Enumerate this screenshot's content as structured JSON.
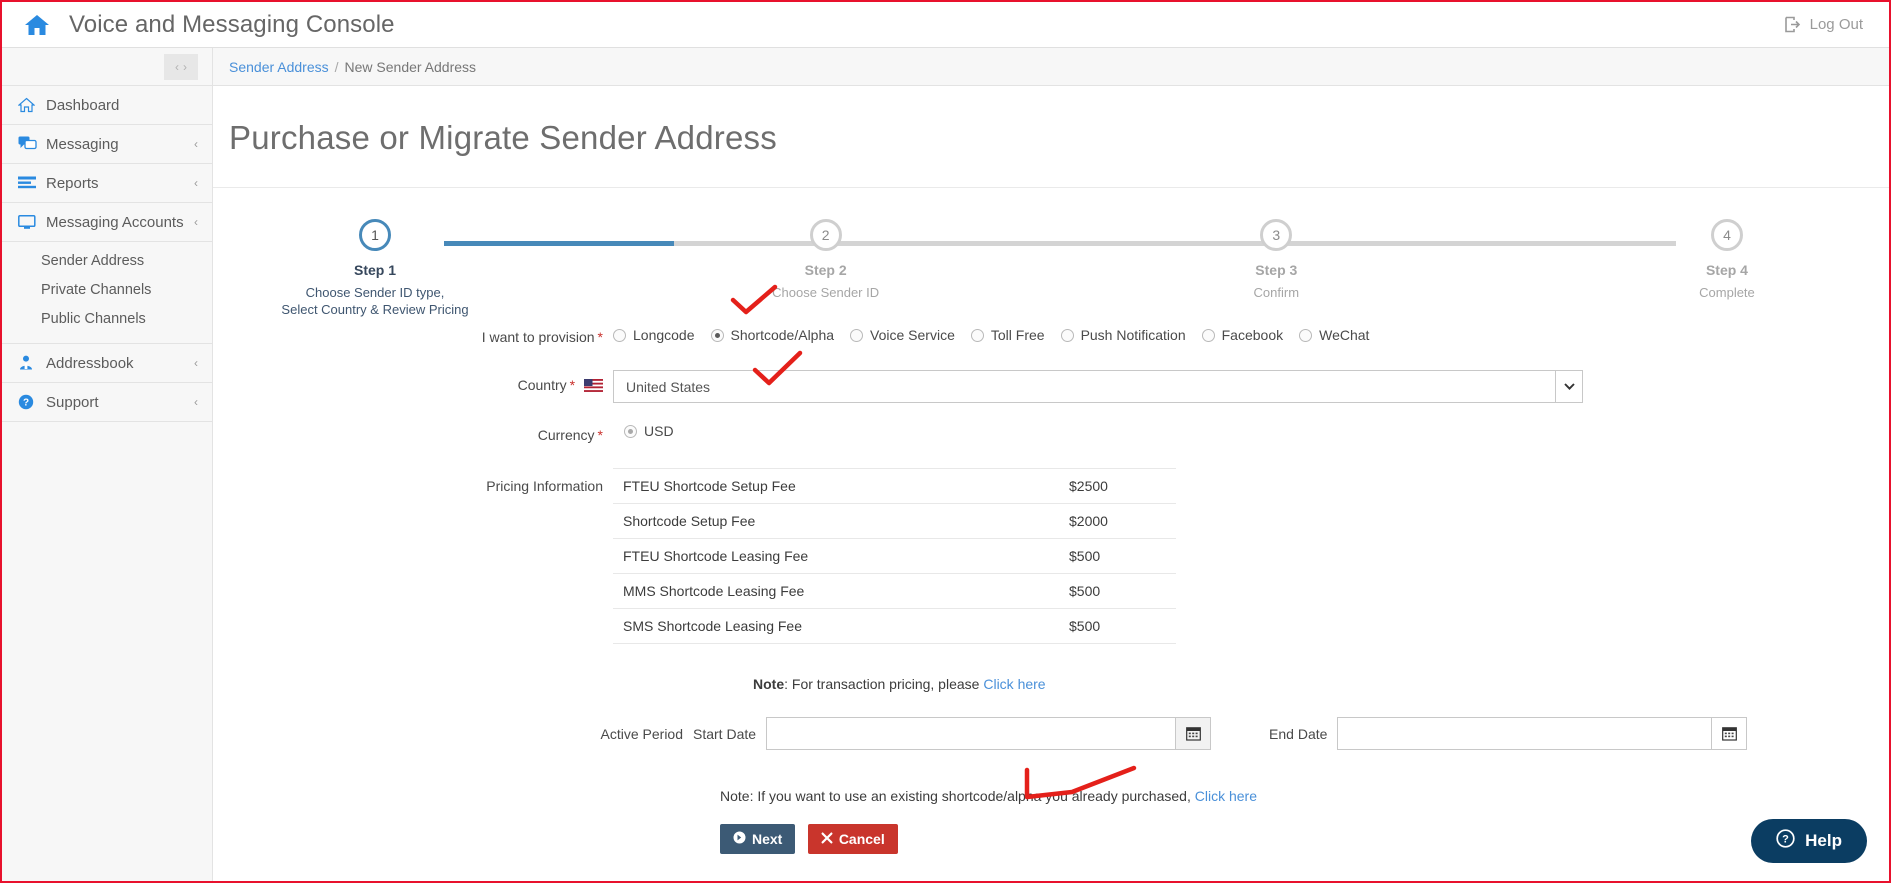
{
  "header": {
    "home_icon": "home-icon",
    "title": "Voice and Messaging Console",
    "logout_label": "Log Out",
    "logout_icon": "logout-icon"
  },
  "sidebar": {
    "collapse_prev": "‹",
    "collapse_next": "›",
    "items": [
      {
        "label": "Dashboard",
        "icon": "dashboard-home-icon",
        "caret": ""
      },
      {
        "label": "Messaging",
        "icon": "messaging-chat-icon",
        "caret": "‹"
      },
      {
        "label": "Reports",
        "icon": "reports-bars-icon",
        "caret": "‹"
      },
      {
        "label": "Messaging Accounts",
        "icon": "monitor-icon",
        "caret": "‹"
      }
    ],
    "sub_items": [
      {
        "label": "Sender Address"
      },
      {
        "label": "Private Channels"
      },
      {
        "label": "Public Channels"
      }
    ],
    "items_bottom": [
      {
        "label": "Addressbook",
        "icon": "addressbook-person-icon",
        "caret": "‹"
      },
      {
        "label": "Support",
        "icon": "support-question-icon",
        "caret": "‹"
      }
    ]
  },
  "breadcrumb": {
    "parent": "Sender Address",
    "separator": "/",
    "current": "New Sender Address"
  },
  "page": {
    "title": "Purchase or Migrate Sender Address"
  },
  "stepper": {
    "steps": [
      {
        "num": "1",
        "name": "Step 1",
        "desc": "Choose Sender ID type,\nSelect Country & Review Pricing",
        "active": true
      },
      {
        "num": "2",
        "name": "Step 2",
        "desc": "Choose Sender ID",
        "active": false
      },
      {
        "num": "3",
        "name": "Step 3",
        "desc": "Confirm",
        "active": false
      },
      {
        "num": "4",
        "name": "Step 4",
        "desc": "Complete",
        "active": false
      }
    ],
    "active_color": "#4789b9",
    "inactive_color": "#d4d4d4"
  },
  "form": {
    "provision": {
      "label": "I want to provision",
      "required": "*",
      "options": [
        {
          "label": "Longcode",
          "checked": false
        },
        {
          "label": "Shortcode/Alpha",
          "checked": true
        },
        {
          "label": "Voice Service",
          "checked": false
        },
        {
          "label": "Toll Free",
          "checked": false
        },
        {
          "label": "Push Notification",
          "checked": false
        },
        {
          "label": "Facebook",
          "checked": false
        },
        {
          "label": "WeChat",
          "checked": false
        }
      ]
    },
    "country": {
      "label": "Country",
      "required": "*",
      "flag_icon": "us-flag-icon",
      "value": "United States",
      "caret_icon": "chevron-down-icon"
    },
    "currency": {
      "label": "Currency",
      "required": "*",
      "value": "USD",
      "checked": true
    },
    "pricing": {
      "label": "Pricing Information",
      "rows": [
        {
          "name": "FTEU Shortcode Setup Fee",
          "amount": "$2500"
        },
        {
          "name": "Shortcode Setup Fee",
          "amount": "$2000"
        },
        {
          "name": "FTEU Shortcode Leasing Fee",
          "amount": "$500"
        },
        {
          "name": "MMS Shortcode Leasing Fee",
          "amount": "$500"
        },
        {
          "name": "SMS Shortcode Leasing Fee",
          "amount": "$500"
        }
      ]
    },
    "pricing_note": {
      "bold": "Note",
      "text": ": For transaction pricing, please ",
      "link": "Click here"
    },
    "active_period": {
      "label": "Active Period",
      "start_label": "Start Date",
      "start_value": "",
      "start_placeholder": "",
      "end_label": "End Date",
      "end_value": "",
      "end_placeholder": "",
      "calendar_icon": "calendar-icon"
    },
    "bottom_note": {
      "text": "Note: If you want to use an existing shortcode/alpha you already purchased, ",
      "link": "Click here"
    },
    "buttons": {
      "next": "Next",
      "next_icon": "arrow-right-circle-icon",
      "cancel": "Cancel",
      "cancel_icon": "x-icon"
    }
  },
  "help": {
    "label": "Help",
    "icon": "question-circle-icon"
  },
  "colors": {
    "accent_blue": "#4a90d9",
    "step_active": "#4789b9",
    "next_button": "#3c5a75",
    "cancel_button": "#c9352c",
    "help_button": "#0b3d62",
    "required_red": "#c9302c",
    "annotation_red": "#e4201a"
  }
}
